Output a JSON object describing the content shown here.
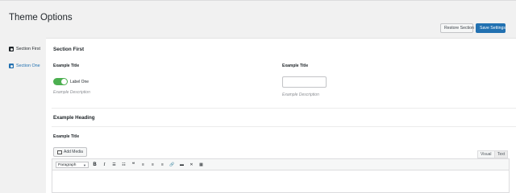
{
  "page": {
    "title": "Theme Options"
  },
  "header": {
    "restore_label": "Restore Section",
    "save_label": "Save Settings"
  },
  "sidebar": {
    "items": [
      {
        "label": "Section First"
      },
      {
        "label": "Section One"
      }
    ]
  },
  "section": {
    "title": "Section First",
    "fields": [
      {
        "title": "Example Title",
        "toggle_label": "Label One",
        "toggle_on": true,
        "description": "Example Description"
      },
      {
        "title": "Example Title",
        "value": "",
        "placeholder": "",
        "description": "Example Description"
      }
    ],
    "heading": "Example Heading",
    "editor": {
      "title": "Example Title",
      "add_media_label": "Add Media",
      "tabs": {
        "visual": "Visual",
        "text": "Text"
      },
      "format_select": "Paragraph"
    }
  },
  "colors": {
    "accent": "#2271b1",
    "toggle_on": "#4caf50"
  }
}
